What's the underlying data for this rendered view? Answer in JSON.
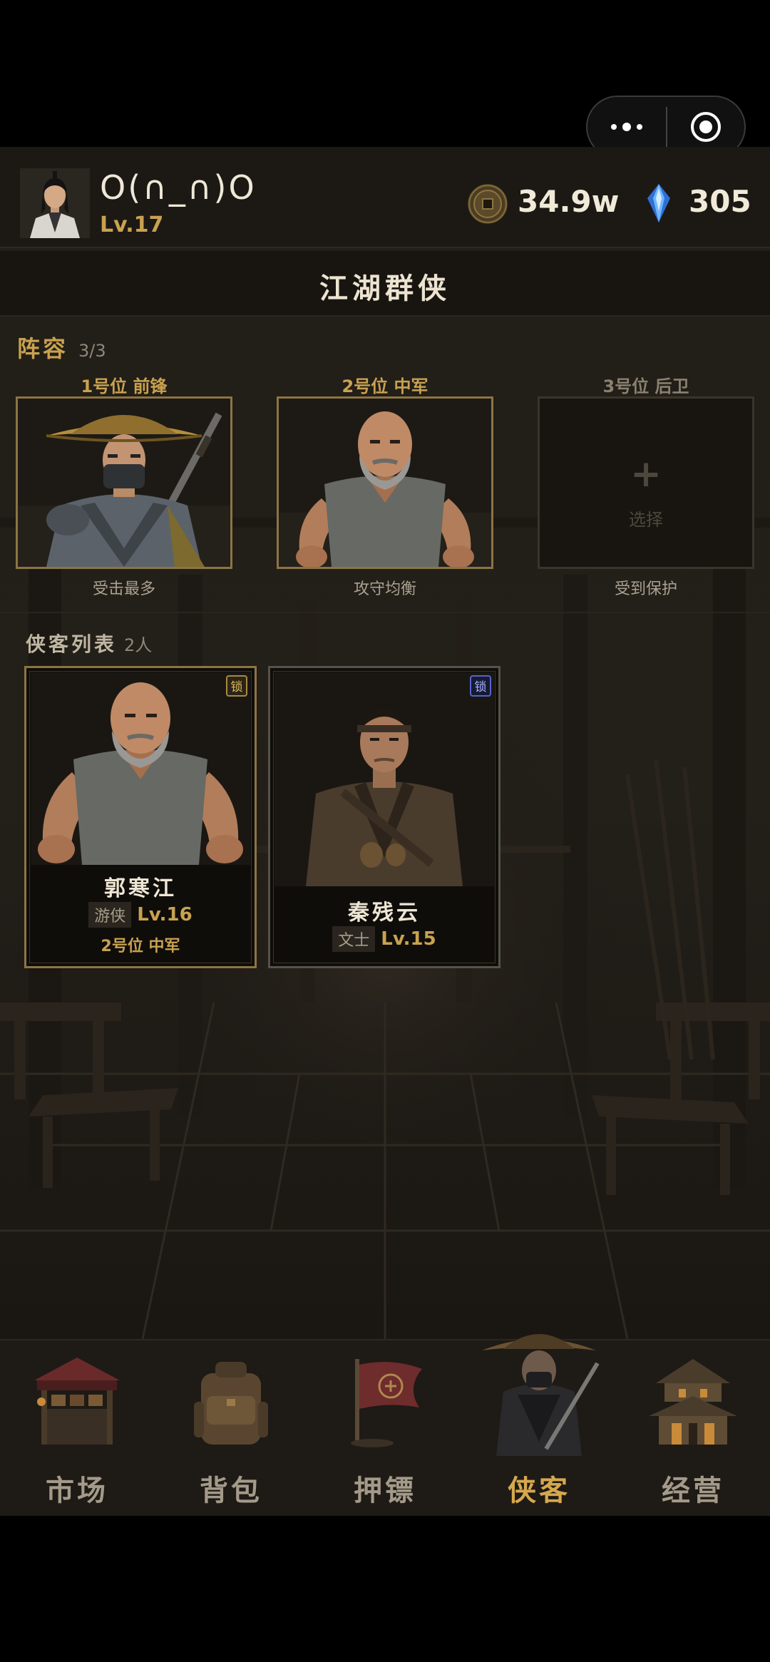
{
  "capsule": {
    "more_icon": "more-dots-icon",
    "close_icon": "target-circle-icon"
  },
  "header": {
    "nickname": "O(∩_∩)O",
    "level": "Lv.17",
    "coins": "34.9w",
    "gems": "305"
  },
  "title": "江湖群侠",
  "lineup": {
    "title": "阵容",
    "count": "3/3",
    "slots": [
      {
        "label": "1号位 前锋",
        "desc": "受击最多"
      },
      {
        "label": "2号位 中军",
        "desc": "攻守均衡"
      },
      {
        "label": "3号位 后卫",
        "desc": "受到保护",
        "plus": "+",
        "select": "选择"
      }
    ]
  },
  "hero_list": {
    "title": "侠客列表",
    "count": "2人",
    "heroes": [
      {
        "lock": "锁",
        "name": "郭寒江",
        "class": "游侠",
        "level": "Lv.16",
        "position": "2号位 中军"
      },
      {
        "lock": "锁",
        "name": "秦残云",
        "class": "文士",
        "level": "Lv.15"
      }
    ]
  },
  "nav": [
    {
      "label": "市场",
      "icon": "market-stall-icon"
    },
    {
      "label": "背包",
      "icon": "backpack-icon"
    },
    {
      "label": "押镖",
      "icon": "escort-flag-icon"
    },
    {
      "label": "侠客",
      "icon": "swordsman-icon",
      "active": true
    },
    {
      "label": "经营",
      "icon": "pavilion-icon"
    }
  ],
  "colors": {
    "accent_gold": "#c9a250",
    "active_nav": "#d6a84e",
    "background": "#1a1713"
  }
}
